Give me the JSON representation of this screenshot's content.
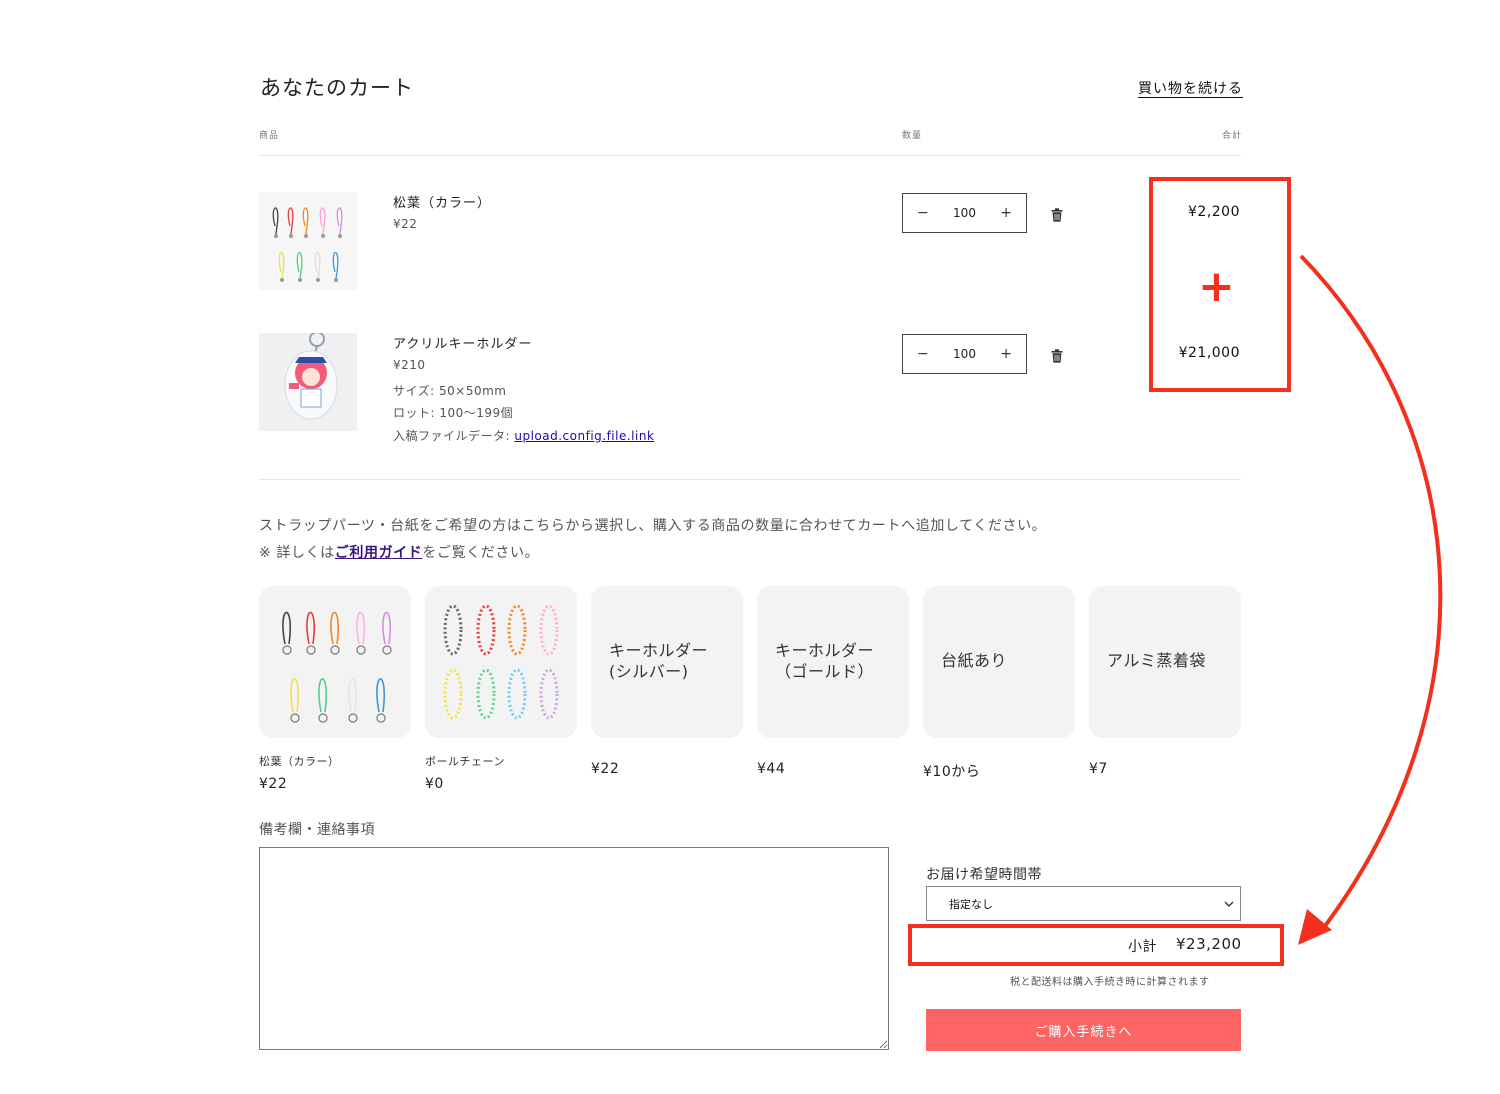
{
  "header": {
    "title": "あなたのカート",
    "continue_link": "買い物を続ける"
  },
  "columns": {
    "product": "商品",
    "quantity": "数量",
    "total": "合計"
  },
  "items": [
    {
      "name": "松葉（カラー）",
      "price": "¥22",
      "qty": "100",
      "total": "¥2,200"
    },
    {
      "name": "アクリルキーホルダー",
      "price": "¥210",
      "size": "サイズ: 50×50mm",
      "lot": "ロット: 100〜199個",
      "file_label": "入稿ファイルデータ: ",
      "file_link": "upload.config.file.link",
      "qty": "100",
      "total": "¥21,000"
    }
  ],
  "qty_controls": {
    "minus": "−",
    "plus": "+"
  },
  "annotation": {
    "plus_sign": "+"
  },
  "addons": {
    "intro": "ストラップパーツ・台紙をご希望の方はこちらから選択し、購入する商品の数量に合わせてカートへ追加してください。",
    "note_prefix": "※ 詳しくは",
    "guide_link": "ご利用ガイド",
    "note_suffix": "をご覧ください。",
    "cards": [
      {
        "name": "松葉（カラー）",
        "price": "¥22"
      },
      {
        "name": "ボールチェーン",
        "price": "¥0"
      },
      {
        "label_line1": "キーホルダー",
        "label_line2": "(シルバー)",
        "price": "¥22"
      },
      {
        "label_line1": "キーホルダー",
        "label_line2": "（ゴールド）",
        "price": "¥44"
      },
      {
        "label_line1": "台紙あり",
        "price": "¥10から"
      },
      {
        "label_line1": "アルミ蒸着袋",
        "price": "¥7"
      }
    ]
  },
  "notes": {
    "label": "備考欄・連絡事項",
    "value": ""
  },
  "delivery": {
    "label": "お届け希望時間帯",
    "selected": "指定なし"
  },
  "summary": {
    "subtotal_label": "小計",
    "subtotal_value": "¥23,200",
    "tax_note": "税と配送料は購入手続き時に計算されます",
    "checkout": "ご購入手続きへ"
  },
  "colors": {
    "accent_red": "#f2301d",
    "checkout_bg": "#ff6464"
  }
}
